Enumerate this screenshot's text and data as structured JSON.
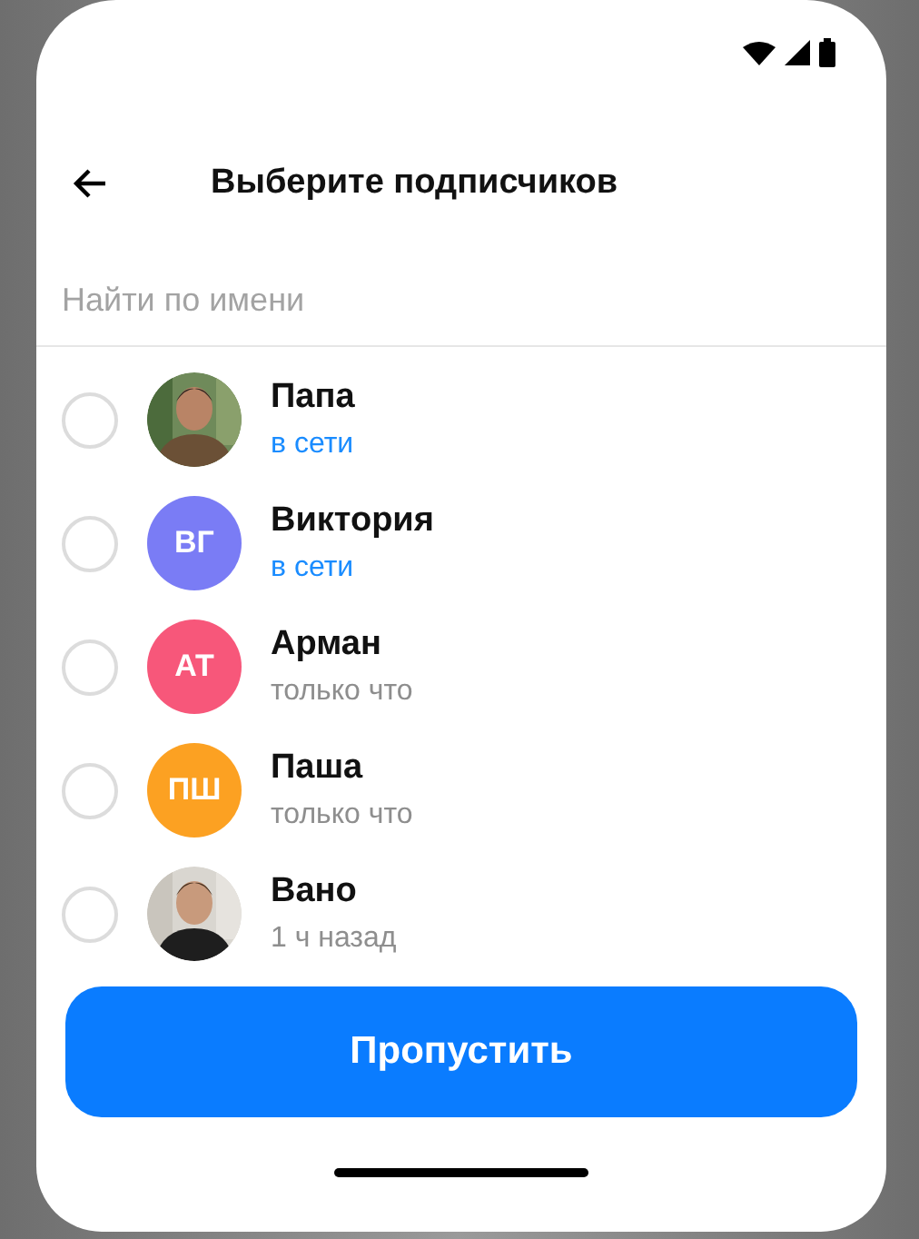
{
  "header": {
    "title": "Выберите подписчиков"
  },
  "search": {
    "placeholder": "Найти по имени"
  },
  "contacts": [
    {
      "name": "Папа",
      "status": "в сети",
      "online": true,
      "selected": false
    },
    {
      "name": "Виктория",
      "status": "в сети",
      "online": true,
      "selected": false,
      "avatar": {
        "kind": "initials",
        "initials": "ВГ",
        "color": "#7a7cf5"
      }
    },
    {
      "name": "Арман",
      "status": "только что",
      "online": false,
      "selected": false,
      "avatar": {
        "kind": "initials",
        "initials": "АТ",
        "color": "#f7577a"
      }
    },
    {
      "name": "Паша",
      "status": "только что",
      "online": false,
      "selected": false,
      "avatar": {
        "kind": "initials",
        "initials": "ПШ",
        "color": "#fca122"
      }
    },
    {
      "name": "Вано",
      "status": "1 ч назад",
      "online": false,
      "selected": false
    }
  ],
  "button": {
    "label": "Пропустить"
  }
}
